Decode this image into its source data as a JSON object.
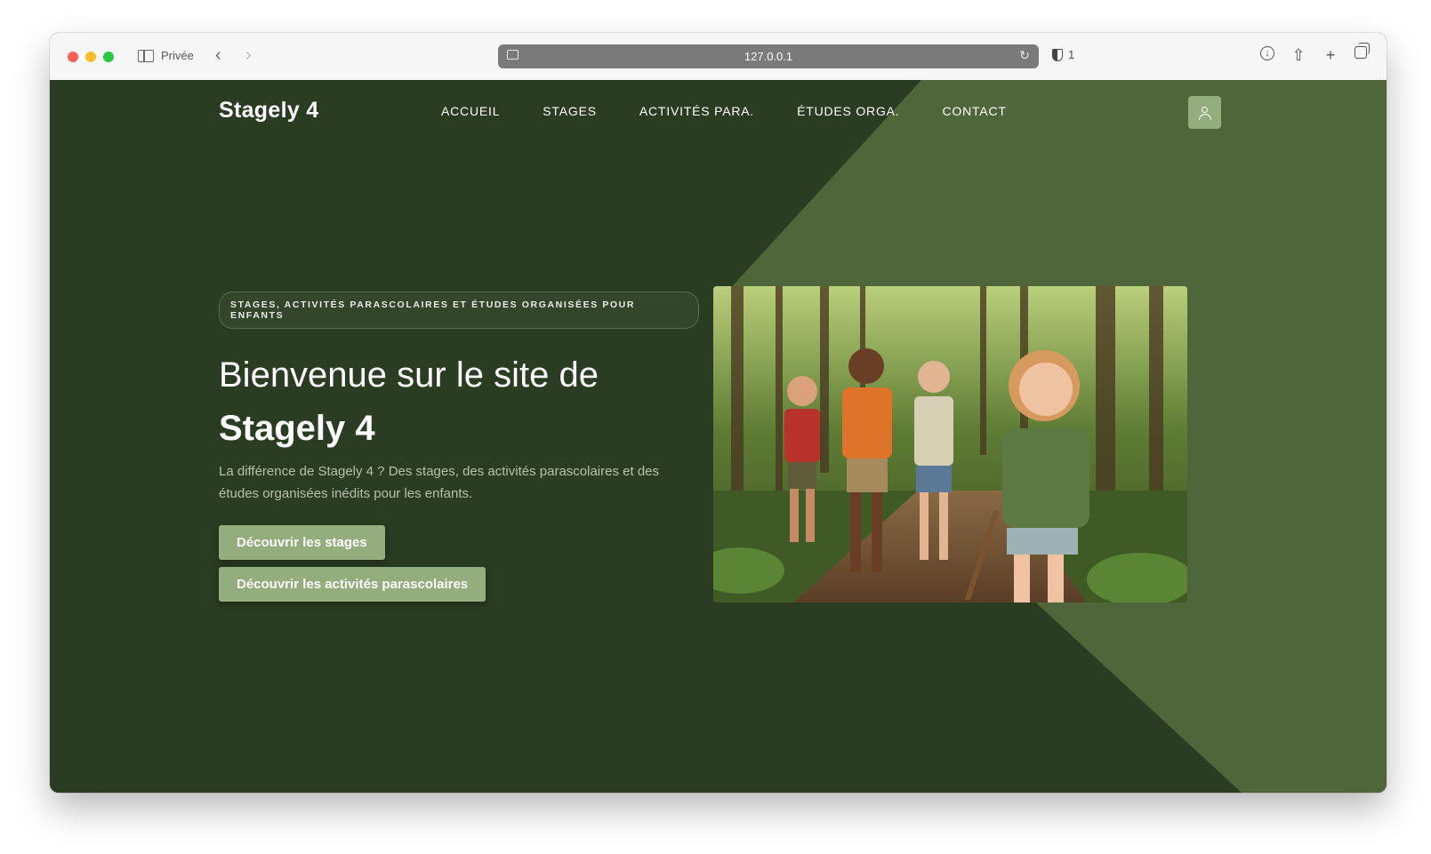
{
  "browser": {
    "private_label": "Privée",
    "url": "127.0.0.1",
    "shield_count": "1"
  },
  "site": {
    "logo": "Stagely 4",
    "nav": [
      {
        "label": "ACCUEIL"
      },
      {
        "label": "STAGES"
      },
      {
        "label": "ACTIVITÉS PARA."
      },
      {
        "label": "ÉTUDES ORGA."
      },
      {
        "label": "CONTACT"
      }
    ]
  },
  "hero": {
    "tagline": "STAGES, ACTIVITÉS PARASCOLAIRES ET ÉTUDES ORGANISÉES POUR ENFANTS",
    "title_line1": "Bienvenue sur le site de",
    "title_line2": "Stagely 4",
    "description": "La différence de Stagely 4 ? Des stages, des activités parascolaires et des études organisées inédits pour les enfants.",
    "button_primary": "Découvrir les stages",
    "button_secondary": "Découvrir les activités parascolaires"
  },
  "colors": {
    "background": "#2a3d22",
    "accent_shape": "#4e6639",
    "button": "#93ae7c"
  },
  "icons": {
    "user": "user-icon",
    "reload": "reload-icon",
    "download": "download-icon",
    "share": "share-icon",
    "new_tab": "plus-icon",
    "tabs": "tabs-icon"
  }
}
